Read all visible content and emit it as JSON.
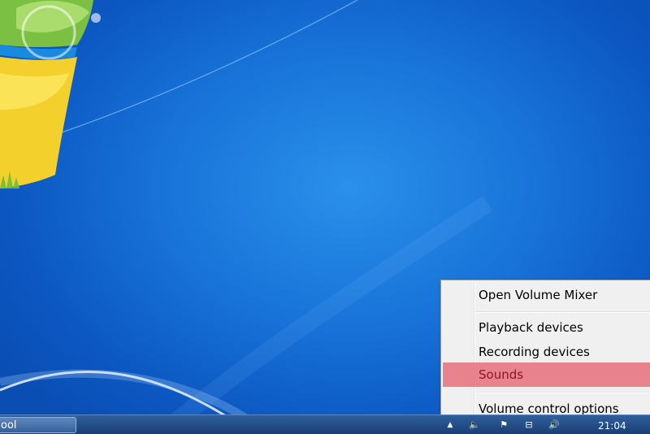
{
  "taskbar": {
    "button_label": "ool",
    "clock": "21:04",
    "tray_arrow": "▲",
    "tray_speaker": "🔈",
    "tray_flag": "⚑",
    "tray_network": "⊟",
    "tray_volume": "🔊"
  },
  "context_menu": {
    "items": [
      {
        "label": "Open Volume Mixer"
      },
      {
        "label": "Playback devices"
      },
      {
        "label": "Recording devices"
      },
      {
        "label": "Sounds",
        "highlighted": true
      },
      {
        "label": "Volume control options"
      }
    ]
  },
  "colors": {
    "desktop_blue": "#1873d8",
    "menu_highlight": "#e8828c",
    "highlight_text": "#8a1622"
  }
}
